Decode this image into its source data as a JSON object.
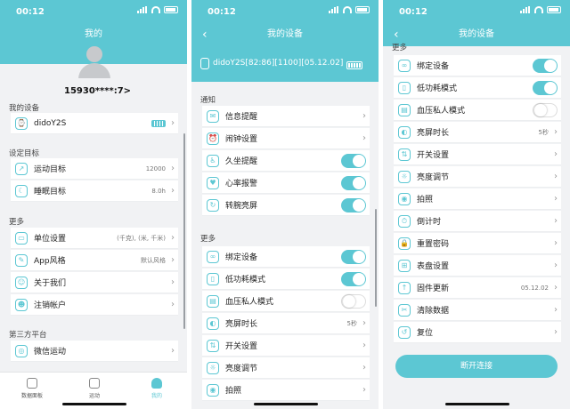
{
  "status_time": "00:12",
  "colors": {
    "accent": "#5cc7d3"
  },
  "p1": {
    "title": "我的",
    "phone": "15930****:7>",
    "sec_device": "我的设备",
    "device_name": "didoY2S",
    "sec_goals": "设定目标",
    "sport_goal": "运动目标",
    "sport_goal_value": "12000",
    "sleep_goal": "睡眠目标",
    "sleep_goal_value": "8.0h",
    "sec_more": "更多",
    "unit": "单位设置",
    "unit_value": "(千克), (米, 千米)",
    "app_style": "App风格",
    "app_style_value": "默认风格",
    "about": "关于我们",
    "logout": "注销帐户",
    "sec_third": "第三方平台",
    "wechat": "微信运动",
    "tabs": [
      "数据面板",
      "运动",
      "我的"
    ]
  },
  "p2": {
    "title": "我的设备",
    "device_line": "didoY2S[82:86][1100][05.12.02]",
    "sec_notify": "通知",
    "notify": [
      "信息提醒",
      "闹钟设置",
      "久坐提醒",
      "心率报警",
      "转腕亮屏"
    ],
    "sec_more": "更多",
    "more": [
      "绑定设备",
      "低功耗模式",
      "血压私人模式",
      "亮屏时长",
      "开关设置",
      "亮度调节",
      "拍照"
    ],
    "screen_value": "5秒"
  },
  "p3": {
    "title": "我的设备",
    "sec_more": "更多",
    "items": [
      "绑定设备",
      "低功耗模式",
      "血压私人模式",
      "亮屏时长",
      "开关设置",
      "亮度调节",
      "拍照",
      "倒计时",
      "重置密码",
      "表盘设置",
      "固件更新",
      "清除数据",
      "复位"
    ],
    "screen_value": "5秒",
    "firmware_value": "05.12.02",
    "disconnect": "断开连接"
  }
}
